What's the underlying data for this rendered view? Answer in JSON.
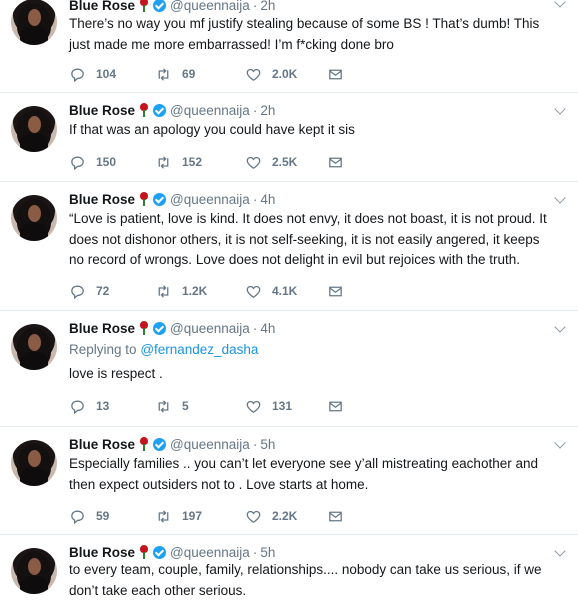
{
  "icons": {
    "reply": "reply-icon",
    "retweet": "retweet-icon",
    "like": "heart-icon",
    "dm": "envelope-icon",
    "more": "chevron-down-icon",
    "verified": "verified-badge-icon",
    "emoji": "rose-emoji-icon"
  },
  "colors": {
    "link": "#1b95e0",
    "verified": "#1da1f2",
    "muted": "#657786",
    "divider": "#e6ecf0"
  },
  "tweets": [
    {
      "name": "Blue Rose",
      "handle": "@queennaija",
      "sep": "·",
      "time": "2h",
      "lines": [
        "There’s no way you mf justify stealing because of some BS ! That’s dumb! This",
        "just made me more embarrassed! I’m f*cking done bro"
      ],
      "replies": "104",
      "retweets": "69",
      "likes": "2.0K"
    },
    {
      "name": "Blue Rose",
      "handle": "@queennaija",
      "sep": "·",
      "time": "2h",
      "lines": [
        "If that was an apology you could have kept it sis"
      ],
      "replies": "150",
      "retweets": "152",
      "likes": "2.5K"
    },
    {
      "name": "Blue Rose",
      "handle": "@queennaija",
      "sep": "·",
      "time": "4h",
      "lines": [
        "“Love is patient, love is kind. It does not envy, it does not boast, it is not proud. It",
        "does not dishonor others, it is not self-seeking, it is not easily angered, it keeps",
        "no record of wrongs. Love does not delight in evil but rejoices with the truth."
      ],
      "replies": "72",
      "retweets": "1.2K",
      "likes": "4.1K"
    },
    {
      "name": "Blue Rose",
      "handle": "@queennaija",
      "sep": "·",
      "time": "4h",
      "replying_prefix": "Replying to",
      "replying_to": "@fernandez_dasha",
      "lines": [
        "love is respect ."
      ],
      "replies": "13",
      "retweets": "5",
      "likes": "131"
    },
    {
      "name": "Blue Rose",
      "handle": "@queennaija",
      "sep": "·",
      "time": "5h",
      "lines": [
        "Especially families .. you can’t let everyone see y’all mistreating eachother and",
        "then expect outsiders not to . Love starts at home."
      ],
      "replies": "59",
      "retweets": "197",
      "likes": "2.2K"
    },
    {
      "name": "Blue Rose",
      "handle": "@queennaija",
      "sep": "·",
      "time": "5h",
      "lines": [
        "to every team, couple, family, relationships.... nobody can take us serious, if we",
        "don’t take each other serious."
      ]
    }
  ]
}
